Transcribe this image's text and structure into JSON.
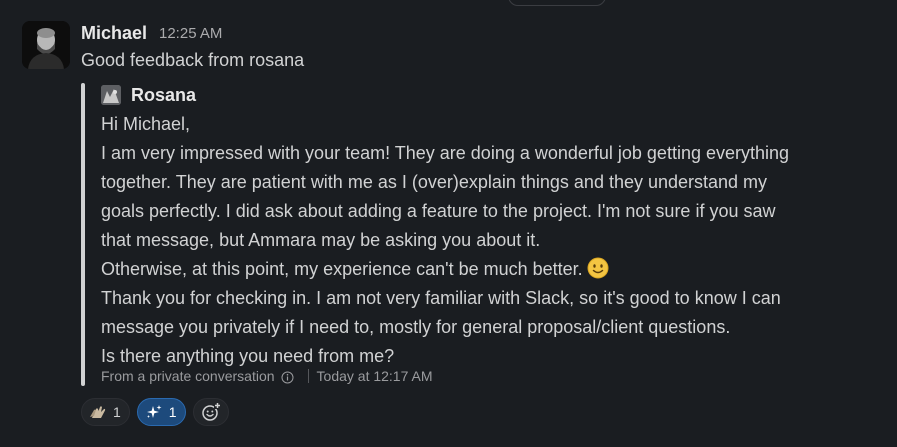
{
  "message": {
    "sender": "Michael",
    "time": "12:25 AM",
    "text": "Good feedback from rosana"
  },
  "quote": {
    "author": "Rosana",
    "lines": [
      "Hi Michael,",
      "I am very impressed with your team! They are doing a wonderful job getting everything",
      "together. They are patient with me as I (over)explain things and they understand my",
      "goals perfectly. I did ask about adding a feature to the project. I'm not sure if you saw",
      "that message, but Ammara may be asking you about it.",
      "Otherwise, at this point, my experience can't be much better.",
      "Thank you for checking in. I am not very familiar with Slack, so it's good to know I can",
      "message you privately if I need to, mostly for general proposal/client questions.",
      "Is there anything you need from me?"
    ],
    "source": "From a private conversation",
    "source_time": "Today at 12:17 AM"
  },
  "reactions": [
    {
      "icon": "clapping-hands-icon",
      "count": "1",
      "active": false
    },
    {
      "icon": "sparkles-icon",
      "count": "1",
      "active": true
    }
  ],
  "add_reaction_icon": "add-emoji-icon",
  "colors": {
    "background": "#1a1d21",
    "text": "#d1d2d3",
    "muted": "#ababad",
    "active_reaction_bg": "#1d4a7c",
    "active_reaction_border": "#2a6ab0"
  }
}
